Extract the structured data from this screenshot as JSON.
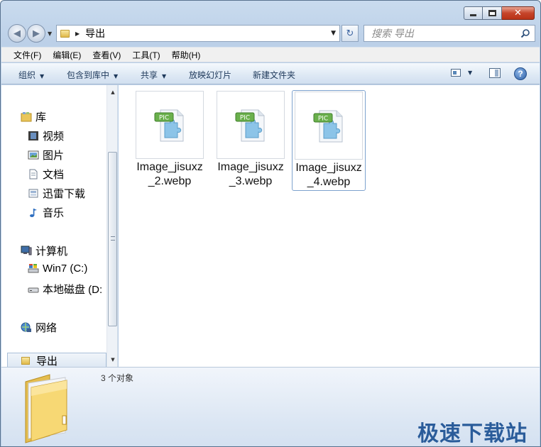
{
  "window": {
    "breadcrumb_current": "导出"
  },
  "search": {
    "placeholder": "搜索 导出"
  },
  "menubar": {
    "items": [
      "文件(F)",
      "编辑(E)",
      "查看(V)",
      "工具(T)",
      "帮助(H)"
    ]
  },
  "toolbar": {
    "organize": "组织",
    "include_in_library": "包含到库中",
    "share": "共享",
    "slideshow": "放映幻灯片",
    "new_folder": "新建文件夹"
  },
  "navpane": {
    "libraries": "库",
    "videos": "视频",
    "pictures": "图片",
    "documents": "文档",
    "thunder": "迅雷下载",
    "music": "音乐",
    "computer": "计算机",
    "drive_c": "Win7 (C:)",
    "drive_d": "本地磁盘 (D:",
    "network": "网络",
    "export": "导出"
  },
  "files": [
    {
      "name": "Image_jisuxz_2.webp",
      "selected": false
    },
    {
      "name": "Image_jisuxz_3.webp",
      "selected": false
    },
    {
      "name": "Image_jisuxz_4.webp",
      "selected": true
    }
  ],
  "icon_badge": "PIC",
  "details": {
    "count": "3 个对象"
  },
  "watermark": "极速下载站",
  "colors": {
    "accent": "#2a5c9a",
    "badge_green": "#6ab04c",
    "puzzle_blue": "#8cc4e8"
  }
}
